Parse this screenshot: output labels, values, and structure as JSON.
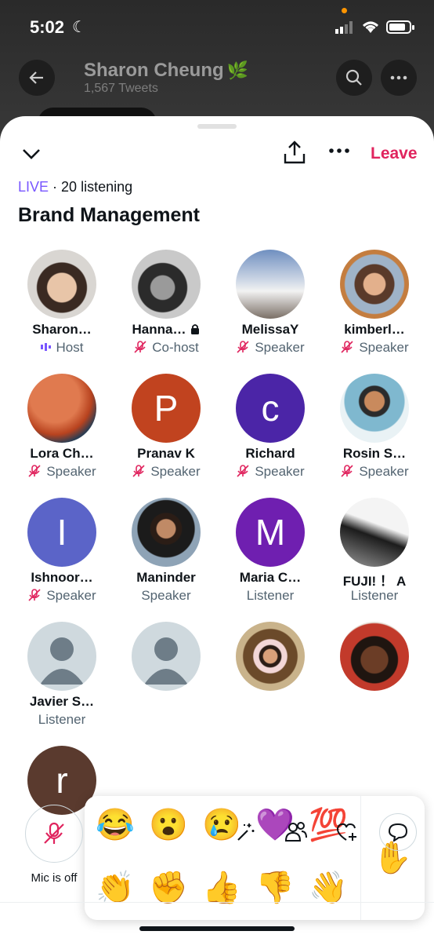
{
  "status_bar": {
    "time": "5:02"
  },
  "background": {
    "profile_name": "Sharon Cheung",
    "tweet_count": "1,567 Tweets"
  },
  "space": {
    "live_label": "LIVE",
    "listening": "· 20 listening",
    "title": "Brand Management",
    "leave_label": "Leave"
  },
  "participants": [
    {
      "name": "Sharon…",
      "role": "Host"
    },
    {
      "name": "Hanna…",
      "role": "Co-host"
    },
    {
      "name": "MelissaY",
      "role": "Speaker"
    },
    {
      "name": "kimberl…",
      "role": "Speaker"
    },
    {
      "name": "Lora Ch…",
      "role": "Speaker"
    },
    {
      "name": "Pranav K",
      "role": "Speaker",
      "initial": "P",
      "color": "#c1431f"
    },
    {
      "name": "Richard",
      "role": "Speaker",
      "initial": "c",
      "color": "#4b25a7"
    },
    {
      "name": "Rosin S…",
      "role": "Speaker"
    },
    {
      "name": "Ishnoor…",
      "role": "Speaker",
      "initial": "I",
      "color": "#5b64c8"
    },
    {
      "name": "Maninder",
      "role": "Speaker"
    },
    {
      "name": "Maria C…",
      "role": "Listener",
      "initial": "M",
      "color": "#6f1fb0"
    },
    {
      "name": "FUJI!  ！ A",
      "role": "Listener"
    },
    {
      "name": "Javier S…",
      "role": "Listener"
    },
    {
      "name": "",
      "role": ""
    },
    {
      "name": "",
      "role": ""
    },
    {
      "name": "",
      "role": ""
    },
    {
      "name": "",
      "role": "",
      "initial": "r",
      "color": "#5a3a2e"
    }
  ],
  "reactions": {
    "row1": [
      "😂",
      "😮",
      "😢",
      "💜",
      "💯"
    ],
    "row2": [
      "👏",
      "✊",
      "👍",
      "👎",
      "👋"
    ],
    "raise_hand": "✋"
  },
  "bottom": {
    "mic_label": "Mic is off"
  },
  "colors": {
    "accent_live": "#7856ff",
    "leave": "#e0245e",
    "muted_pink": "#e0245e"
  }
}
